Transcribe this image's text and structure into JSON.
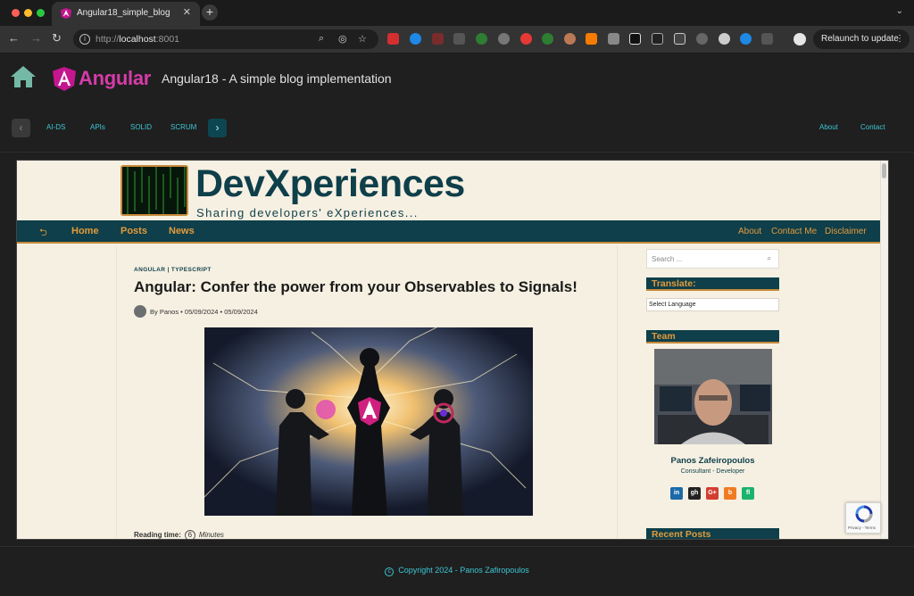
{
  "browser": {
    "tab_title": "Angular18_simple_blog",
    "tab_close": "✕",
    "new_tab": "+",
    "url_host": "localhost",
    "url_prefix": "http://",
    "url_port": ":8001",
    "relaunch_label": "Relaunch to update",
    "colors": {
      "tab_bg": "#333333",
      "toolbar": "#333333"
    }
  },
  "app": {
    "brand": "Angular",
    "title": "Angular18 - A simple blog implementation",
    "nav_items": [
      "AI-DS",
      "APIs",
      "SOLID",
      "SCRUM"
    ],
    "nav_right": [
      "About",
      "Contact"
    ],
    "footer": "Copyright 2024 - Panos Zafiropoulos",
    "colors": {
      "accent": "#3cc6d4",
      "brand": "#d63ba8"
    }
  },
  "blog": {
    "title": "DevXperiences",
    "tagline": "Sharing developers' eXperiences...",
    "nav_back": "⮌",
    "nav": [
      "Home",
      "Posts",
      "News"
    ],
    "nav_right": [
      "About",
      "Contact Me",
      "Disclaimer"
    ],
    "post": {
      "categories": "ANGULAR | TYPESCRIPT",
      "title": "Angular: Confer the power from your Observables to Signals!",
      "byline": "By Panos  •  05/09/2024  •  05/09/2024",
      "reading_label": "Reading time:",
      "reading_value": "6",
      "reading_unit": "Minutes"
    },
    "sidebar": {
      "search_placeholder": "Search ...",
      "translate_title": "Translate:",
      "language_select": "Select Language",
      "team_title": "Team",
      "team_name": "Panos Zafeiropoulos",
      "team_role": "Consultant - Developer",
      "social": [
        "in",
        "gh",
        "G+",
        "b",
        "fl"
      ],
      "recent_title": "Recent Posts"
    },
    "recaptcha": "Privacy - Terms",
    "colors": {
      "bg": "#f6f0e2",
      "primary": "#0e3f4a",
      "accent": "#e59a3a"
    }
  }
}
